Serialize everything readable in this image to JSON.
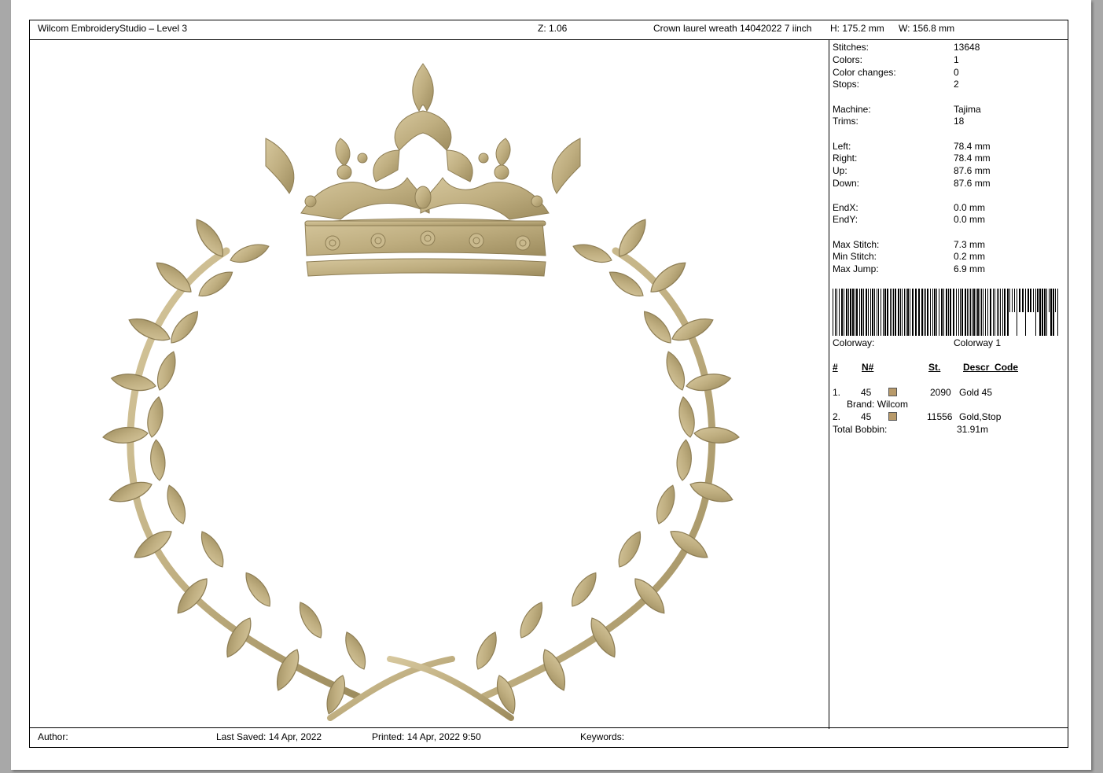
{
  "header": {
    "app_title": "Wilcom EmbroideryStudio – Level 3",
    "zoom": "Z: 1.06",
    "design_name": "Crown laurel wreath 14042022 7 iinch",
    "height": "H: 175.2 mm",
    "width": "W: 156.8 mm"
  },
  "stats": {
    "stitches": {
      "label": "Stitches:",
      "value": "13648"
    },
    "colors": {
      "label": "Colors:",
      "value": "1"
    },
    "color_changes": {
      "label": "Color changes:",
      "value": "0"
    },
    "stops": {
      "label": "Stops:",
      "value": "2"
    },
    "machine": {
      "label": "Machine:",
      "value": "Tajima"
    },
    "trims": {
      "label": "Trims:",
      "value": "18"
    },
    "left": {
      "label": "Left:",
      "value": "78.4 mm"
    },
    "right": {
      "label": "Right:",
      "value": "78.4 mm"
    },
    "up": {
      "label": "Up:",
      "value": "87.6 mm"
    },
    "down": {
      "label": "Down:",
      "value": "87.6 mm"
    },
    "endx": {
      "label": "EndX:",
      "value": "0.0 mm"
    },
    "endy": {
      "label": "EndY:",
      "value": "0.0 mm"
    },
    "max_stitch": {
      "label": "Max Stitch:",
      "value": "7.3 mm"
    },
    "min_stitch": {
      "label": "Min Stitch:",
      "value": "0.2 mm"
    },
    "max_jump": {
      "label": "Max Jump:",
      "value": "6.9 mm"
    }
  },
  "colorway": {
    "label": "Colorway:",
    "value": "Colorway 1"
  },
  "thread_table": {
    "headers": {
      "num": "#",
      "n": "N#",
      "st": "St.",
      "descr": "Descr_Code"
    },
    "rows": [
      {
        "num": "1.",
        "n": "45",
        "color": "#b89a6a",
        "st": "2090",
        "descr": "Gold 45",
        "brand": "Brand: Wilcom"
      },
      {
        "num": "2.",
        "n": "45",
        "color": "#b89a6a",
        "st": "11556",
        "descr": "Gold,Stop"
      }
    ],
    "total_bobbin": {
      "label": "Total Bobbin:",
      "value": "31.91m"
    }
  },
  "footer": {
    "author": "Author:",
    "last_saved": "Last Saved: 14 Apr, 2022",
    "printed": "Printed: 14 Apr, 2022  9:50",
    "keywords": "Keywords:"
  },
  "colors": {
    "thread_gold": "#c0b088",
    "thread_shade": "#8e7e55"
  }
}
